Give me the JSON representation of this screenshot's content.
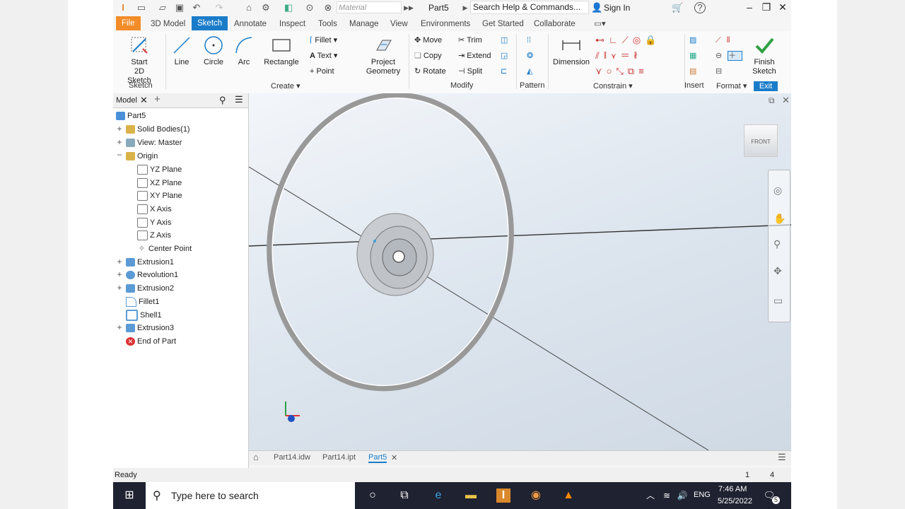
{
  "titlebar": {
    "material_placeholder": "Material",
    "doc_title": "Part5",
    "search_text": "Search Help & Commands...",
    "sign_in": "Sign In",
    "help_icon": "?"
  },
  "tabs": [
    "File",
    "3D Model",
    "Sketch",
    "Annotate",
    "Inspect",
    "Tools",
    "Manage",
    "View",
    "Environments",
    "Get Started",
    "Collaborate"
  ],
  "ribbon": {
    "start_sketch_label": "Start",
    "start_sketch_label2": "2D Sketch",
    "line": "Line",
    "circle": "Circle",
    "arc": "Arc",
    "rectangle": "Rectangle",
    "fillet": "Fillet",
    "text": "Text",
    "point": "Point",
    "project_geometry": "Project",
    "project_geometry2": "Geometry",
    "move": "Move",
    "copy": "Copy",
    "rotate": "Rotate",
    "trim": "Trim",
    "extend": "Extend",
    "split": "Split",
    "dimension": "Dimension",
    "finish_sketch": "Finish",
    "finish_sketch2": "Sketch",
    "panels": {
      "sketch": "Sketch",
      "create": "Create",
      "modify": "Modify",
      "pattern": "Pattern",
      "constrain": "Constrain",
      "insert": "Insert",
      "format": "Format",
      "exit": "Exit"
    }
  },
  "browser": {
    "tab": "Model",
    "items": [
      {
        "label": "Part5"
      },
      {
        "label": "Solid Bodies(1)"
      },
      {
        "label": "View: Master"
      },
      {
        "label": "Origin"
      },
      {
        "label": "YZ Plane"
      },
      {
        "label": "XZ Plane"
      },
      {
        "label": "XY Plane"
      },
      {
        "label": "X Axis"
      },
      {
        "label": "Y Axis"
      },
      {
        "label": "Z Axis"
      },
      {
        "label": "Center Point"
      },
      {
        "label": "Extrusion1"
      },
      {
        "label": "Revolution1"
      },
      {
        "label": "Extrusion2"
      },
      {
        "label": "Fillet1"
      },
      {
        "label": "Shell1"
      },
      {
        "label": "Extrusion3"
      },
      {
        "label": "End of Part"
      }
    ]
  },
  "viewcube": {
    "face": "FRONT"
  },
  "doc_tabs": [
    "Part14.idw",
    "Part14.ipt",
    "Part5"
  ],
  "status": {
    "text": "Ready",
    "num1": "1",
    "num2": "4"
  },
  "taskbar": {
    "search_placeholder": "Type here to search",
    "lang": "ENG",
    "time": "7:46 AM",
    "date": "5/25/2022",
    "notif_count": "5"
  },
  "colors": {
    "accent": "#1a7cc9",
    "file_tab": "#f28c28",
    "finish_check": "#2ea043"
  }
}
